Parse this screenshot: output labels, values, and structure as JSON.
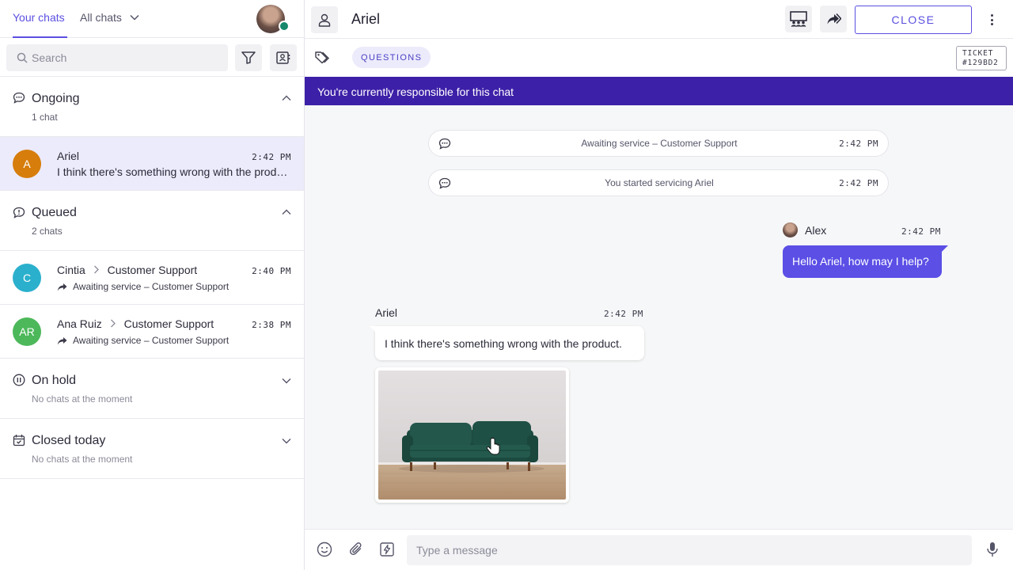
{
  "sidebar": {
    "tabs": [
      {
        "label": "Your chats"
      },
      {
        "label": "All chats"
      }
    ],
    "search": {
      "placeholder": "Search"
    },
    "sections": {
      "ongoing": {
        "title": "Ongoing",
        "count": "1 chat"
      },
      "queued": {
        "title": "Queued",
        "count": "2 chats"
      },
      "on_hold": {
        "title": "On hold",
        "empty": "No chats at the moment"
      },
      "closed_today": {
        "title": "Closed today",
        "empty": "No chats at the moment"
      }
    },
    "ongoing_chats": [
      {
        "initials": "A",
        "name": "Ariel",
        "time": "2:42 PM",
        "message": "I think there's something wrong with the product.",
        "avatar_color": "#d67d0c"
      }
    ],
    "queued_chats": [
      {
        "initials": "C",
        "name": "Cintia",
        "queue": "Customer Support",
        "time": "2:40 PM",
        "status": "Awaiting service – Customer Support",
        "avatar_color": "#2ab0cc"
      },
      {
        "initials": "AR",
        "name": "Ana Ruiz",
        "queue": "Customer Support",
        "time": "2:38 PM",
        "status": "Awaiting service – Customer Support",
        "avatar_color": "#4cb85a"
      }
    ]
  },
  "header": {
    "title": "Ariel",
    "close_label": "CLOSE",
    "tag": "QUESTIONS",
    "ticket_label": "TICKET",
    "ticket_id": "#129BD2"
  },
  "banner": "You're currently responsible for this chat",
  "conversation": {
    "system_messages": [
      {
        "text": "Awaiting service – Customer Support",
        "time": "2:42 PM"
      },
      {
        "text": "You started servicing Ariel",
        "time": "2:42 PM"
      }
    ],
    "agent_message": {
      "name": "Alex",
      "time": "2:42 PM",
      "text": "Hello Ariel, how may I help?"
    },
    "customer_message": {
      "name": "Ariel",
      "time": "2:42 PM",
      "text": "I think there's something wrong with the product."
    }
  },
  "composer": {
    "placeholder": "Type a message"
  },
  "colors": {
    "accent": "#5b4fe0",
    "banner": "#3d20a8",
    "online": "#16876a"
  }
}
